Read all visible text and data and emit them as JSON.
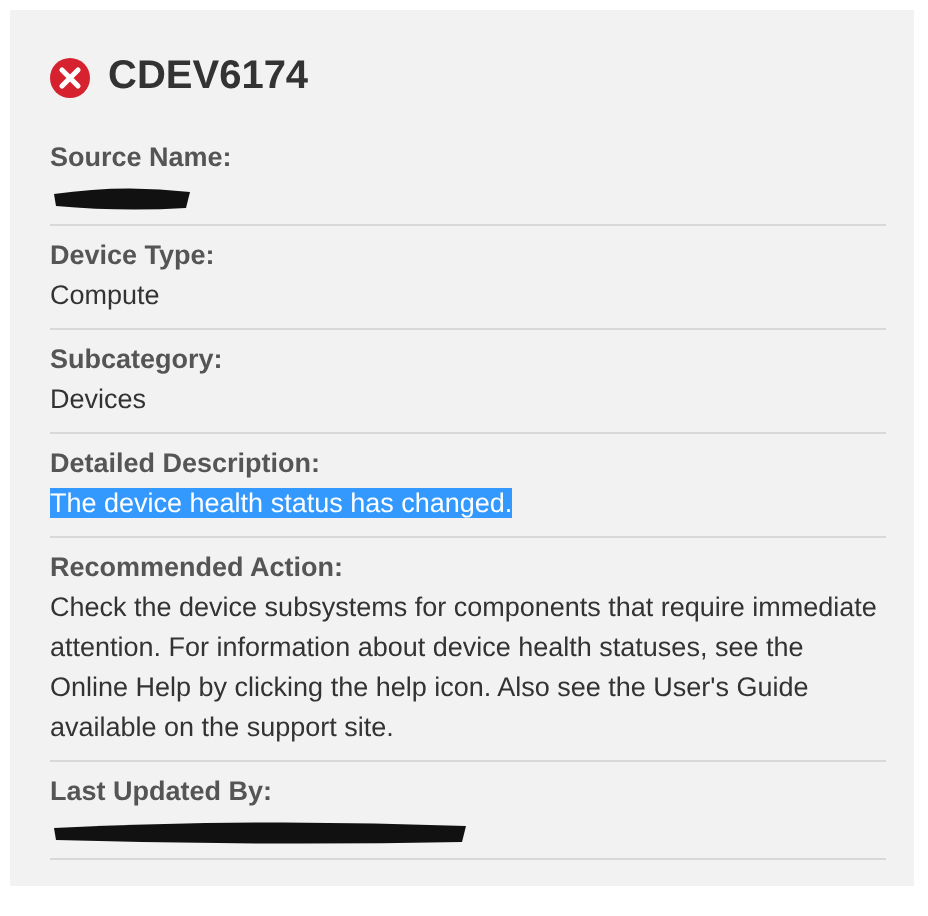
{
  "header": {
    "title": "CDEV6174"
  },
  "fields": [
    {
      "label": "Source Name:",
      "kind": "redacted"
    },
    {
      "label": "Device Type:",
      "value": "Compute",
      "kind": "text"
    },
    {
      "label": "Subcategory:",
      "value": "Devices",
      "kind": "text"
    },
    {
      "label": "Detailed Description:",
      "value": "The device health status has changed.",
      "kind": "highlighted"
    },
    {
      "label": "Recommended Action:",
      "value": "Check the device subsystems for components that require immediate attention. For information about device health statuses, see the Online Help by clicking the help icon. Also see the User's Guide available on the support site.",
      "kind": "text"
    },
    {
      "label": "Last Updated By:",
      "kind": "redacted"
    }
  ]
}
